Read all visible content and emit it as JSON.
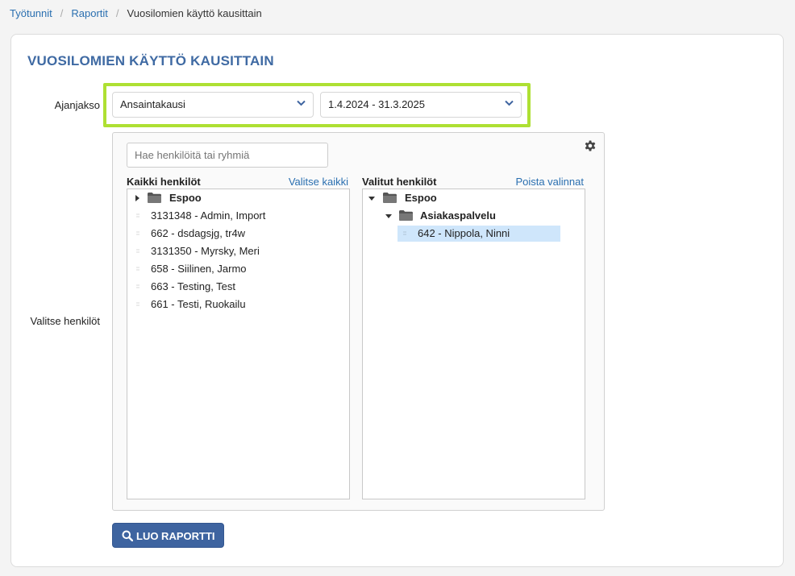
{
  "breadcrumb": {
    "items": [
      {
        "label": "Työtunnit"
      },
      {
        "label": "Raportit"
      },
      {
        "label": "Vuosilomien käyttö kausittain"
      }
    ],
    "separator": "/"
  },
  "page": {
    "title": "VUOSILOMIEN KÄYTTÖ KAUSITTAIN"
  },
  "period": {
    "label": "Ajanjakso",
    "type_value": "Ansaintakausi",
    "range_value": "1.4.2024 - 31.3.2025"
  },
  "persons": {
    "label": "Valitse henkilöt",
    "search_placeholder": "Hae henkilöitä tai ryhmiä",
    "all": {
      "title": "Kaikki henkilöt",
      "action": "Valitse kaikki",
      "group": "Espoo",
      "people": [
        "3131348 - Admin, Import",
        "662 - dsdagsjg, tr4w",
        "3131350 - Myrsky, Meri",
        "658 - Siilinen, Jarmo",
        "663 - Testing, Test",
        "661 - Testi, Ruokailu"
      ]
    },
    "selected": {
      "title": "Valitut henkilöt",
      "action": "Poista valinnat",
      "group": "Espoo",
      "subgroup": "Asiakaspalvelu",
      "people": [
        "642 - Nippola, Ninni"
      ]
    }
  },
  "actions": {
    "create_report": "LUO RAPORTTI"
  },
  "colors": {
    "accent": "#3e64a0",
    "title": "#3f6aa3",
    "link": "#2a6fb0",
    "highlight": "#aee033",
    "selected_row": "#cfe6fb"
  },
  "icons": {
    "settings": "gear-icon",
    "folder": "folder-icon",
    "expand": "caret-icon",
    "dropdown": "chevron-down-icon",
    "search": "search-icon"
  }
}
